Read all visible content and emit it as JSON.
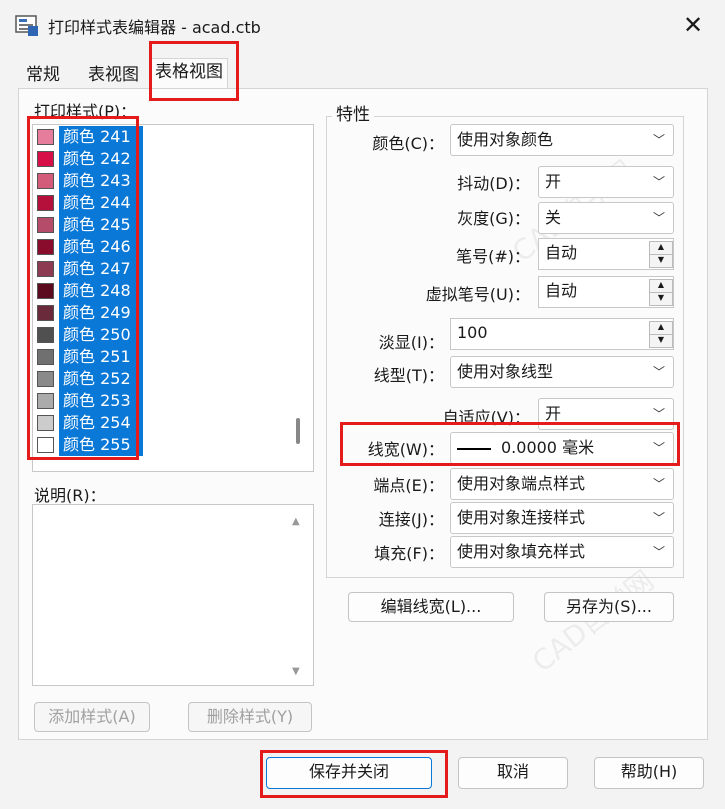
{
  "window": {
    "title": "打印样式表编辑器 - acad.ctb",
    "close_glyph": "✕"
  },
  "tabs": [
    {
      "label": "常规"
    },
    {
      "label": "表视图"
    },
    {
      "label": "表格视图"
    }
  ],
  "styles_list": {
    "label": "打印样式(P)：",
    "items": [
      {
        "label": "颜色 241",
        "color": "#e67d9c"
      },
      {
        "label": "颜色 242",
        "color": "#d60f48"
      },
      {
        "label": "颜色 243",
        "color": "#d35c7b"
      },
      {
        "label": "颜色 244",
        "color": "#b50f3c"
      },
      {
        "label": "颜色 245",
        "color": "#b54c6a"
      },
      {
        "label": "颜色 246",
        "color": "#8a0c2d"
      },
      {
        "label": "颜色 247",
        "color": "#8c3b53"
      },
      {
        "label": "颜色 248",
        "color": "#5c0a1e"
      },
      {
        "label": "颜色 249",
        "color": "#6a2a3c"
      },
      {
        "label": "颜色 250",
        "color": "#505050"
      },
      {
        "label": "颜色 251",
        "color": "#707070"
      },
      {
        "label": "颜色 252",
        "color": "#8a8a8a"
      },
      {
        "label": "颜色 253",
        "color": "#ababab"
      },
      {
        "label": "颜色 254",
        "color": "#cccccc"
      },
      {
        "label": "颜色 255",
        "color": "#ffffff"
      }
    ]
  },
  "description": {
    "label": "说明(R)："
  },
  "list_buttons": {
    "add": "添加样式(A)",
    "delete": "删除样式(Y)"
  },
  "properties": {
    "title": "特性",
    "color": {
      "label": "颜色(C)：",
      "value": "使用对象颜色"
    },
    "dither": {
      "label": "抖动(D)：",
      "value": "开"
    },
    "grayscale": {
      "label": "灰度(G)：",
      "value": "关"
    },
    "pen": {
      "label": "笔号(#)：",
      "value": "自动"
    },
    "virtual_pen": {
      "label": "虚拟笔号(U)：",
      "value": "自动"
    },
    "screening": {
      "label": "淡显(I)：",
      "value": "100"
    },
    "linetype": {
      "label": "线型(T)：",
      "value": "使用对象线型"
    },
    "adaptive": {
      "label": "自适应(V)：",
      "value": "开"
    },
    "lineweight": {
      "label": "线宽(W)：",
      "value": "0.0000 毫米"
    },
    "endstyle": {
      "label": "端点(E)：",
      "value": "使用对象端点样式"
    },
    "joinstyle": {
      "label": "连接(J)：",
      "value": "使用对象连接样式"
    },
    "fillstyle": {
      "label": "填充(F)：",
      "value": "使用对象填充样式"
    }
  },
  "prop_buttons": {
    "edit_lineweights": "编辑线宽(L)...",
    "save_as": "另存为(S)..."
  },
  "footer": {
    "save_close": "保存并关闭",
    "cancel": "取消",
    "help": "帮助(H)"
  },
  "accent": "#0a78d7",
  "highlight": "#e41b1b"
}
